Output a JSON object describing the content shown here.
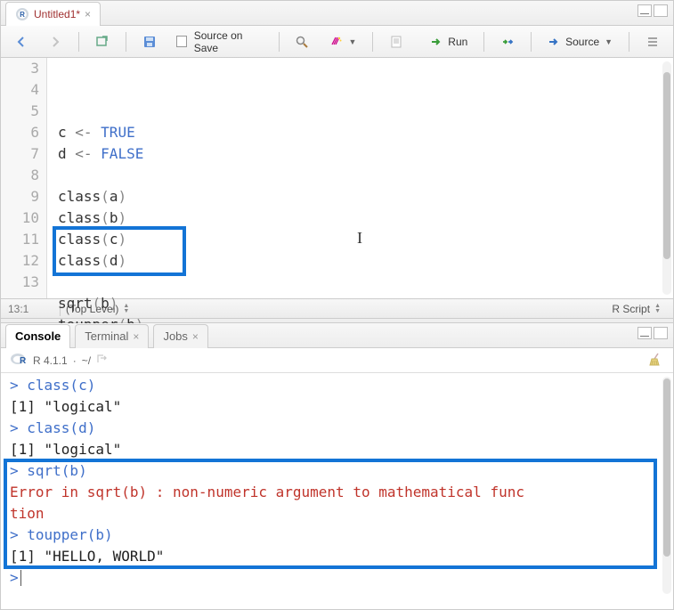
{
  "editor": {
    "tab_title": "Untitled1*",
    "gutter_start": 3,
    "lines": [
      {
        "n": 3,
        "tokens": [
          {
            "t": "c ",
            "c": "ident"
          },
          {
            "t": "<-",
            "c": "op"
          },
          {
            "t": " ",
            "c": "ident"
          },
          {
            "t": "TRUE",
            "c": "const"
          }
        ]
      },
      {
        "n": 4,
        "tokens": [
          {
            "t": "d ",
            "c": "ident"
          },
          {
            "t": "<-",
            "c": "op"
          },
          {
            "t": " ",
            "c": "ident"
          },
          {
            "t": "FALSE",
            "c": "const"
          }
        ]
      },
      {
        "n": 5,
        "tokens": []
      },
      {
        "n": 6,
        "tokens": [
          {
            "t": "class",
            "c": "ident"
          },
          {
            "t": "(",
            "c": "paren"
          },
          {
            "t": "a",
            "c": "ident"
          },
          {
            "t": ")",
            "c": "paren"
          }
        ]
      },
      {
        "n": 7,
        "tokens": [
          {
            "t": "class",
            "c": "ident"
          },
          {
            "t": "(",
            "c": "paren"
          },
          {
            "t": "b",
            "c": "ident"
          },
          {
            "t": ")",
            "c": "paren"
          }
        ]
      },
      {
        "n": 8,
        "tokens": [
          {
            "t": "class",
            "c": "ident"
          },
          {
            "t": "(",
            "c": "paren"
          },
          {
            "t": "c",
            "c": "ident"
          },
          {
            "t": ")",
            "c": "paren"
          }
        ]
      },
      {
        "n": 9,
        "tokens": [
          {
            "t": "class",
            "c": "ident"
          },
          {
            "t": "(",
            "c": "paren"
          },
          {
            "t": "d",
            "c": "ident"
          },
          {
            "t": ")",
            "c": "paren"
          }
        ]
      },
      {
        "n": 10,
        "tokens": []
      },
      {
        "n": 11,
        "tokens": [
          {
            "t": "sqrt",
            "c": "ident"
          },
          {
            "t": "(",
            "c": "paren"
          },
          {
            "t": "b",
            "c": "ident"
          },
          {
            "t": ")",
            "c": "paren"
          }
        ]
      },
      {
        "n": 12,
        "tokens": [
          {
            "t": "toupper",
            "c": "ident"
          },
          {
            "t": "(",
            "c": "paren"
          },
          {
            "t": "b",
            "c": "ident"
          },
          {
            "t": ")",
            "c": "paren"
          }
        ]
      },
      {
        "n": 13,
        "tokens": []
      }
    ],
    "highlight": {
      "rows": [
        11,
        12
      ]
    },
    "status_pos": "13:1",
    "status_scope": "(Top Level)",
    "status_type": "R Script"
  },
  "toolbar": {
    "source_on_save": "Source on Save",
    "run": "Run",
    "source": "Source"
  },
  "console": {
    "tabs": [
      "Console",
      "Terminal",
      "Jobs"
    ],
    "active_tab": 0,
    "version": "R 4.1.1",
    "wd": "~/",
    "lines": [
      {
        "kind": "input",
        "text": "class(c)"
      },
      {
        "kind": "output",
        "text": "[1] \"logical\""
      },
      {
        "kind": "input",
        "text": "class(d)"
      },
      {
        "kind": "output",
        "text": "[1] \"logical\""
      },
      {
        "kind": "input",
        "text": "sqrt(b)"
      },
      {
        "kind": "error",
        "text": "Error in sqrt(b) : non-numeric argument to mathematical func"
      },
      {
        "kind": "error",
        "text": "tion"
      },
      {
        "kind": "input",
        "text": "toupper(b)"
      },
      {
        "kind": "output",
        "text": "[1] \"HELLO, WORLD\""
      },
      {
        "kind": "prompt",
        "text": ""
      }
    ],
    "highlight_rows": [
      4,
      5,
      6,
      7,
      8
    ]
  },
  "colors": {
    "highlight": "#1374d6"
  }
}
